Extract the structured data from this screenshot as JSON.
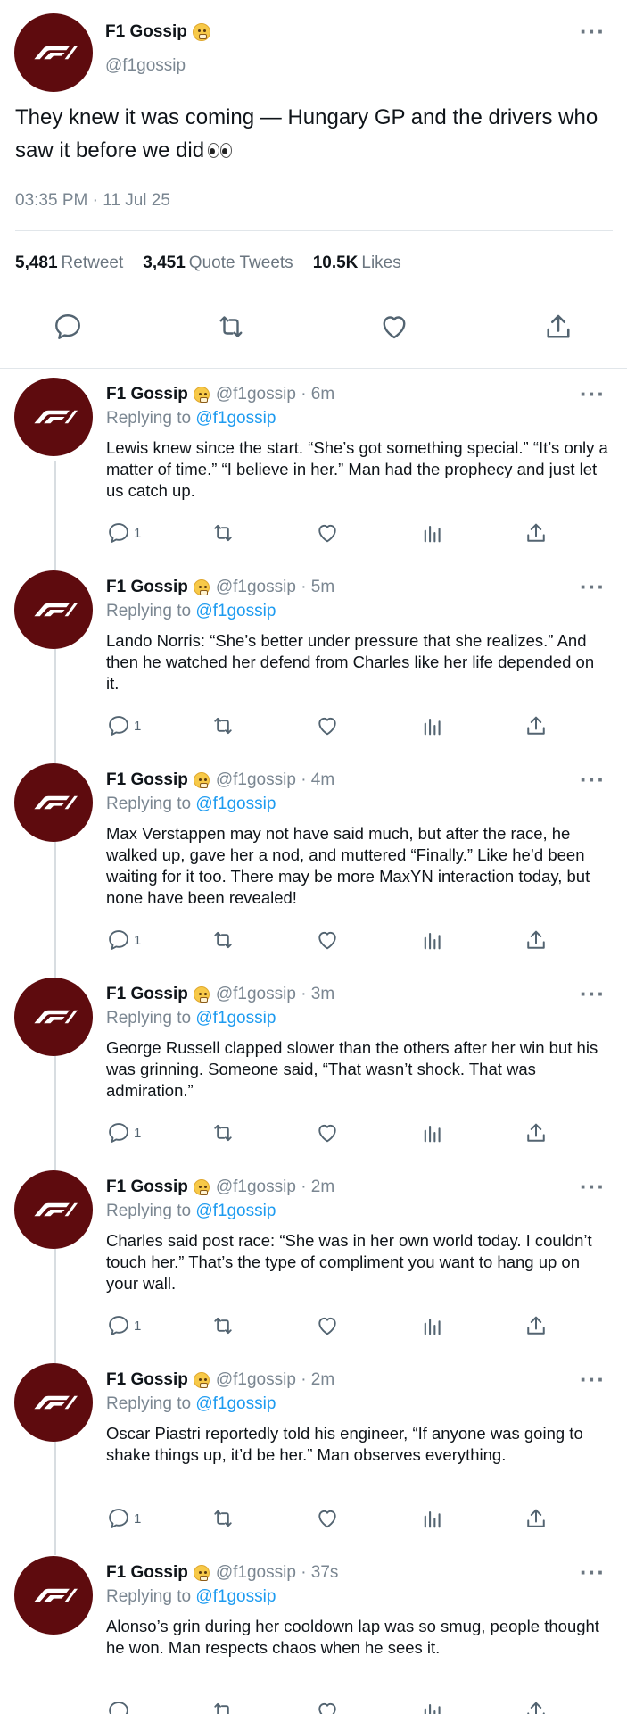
{
  "main_tweet": {
    "name": "F1 Gossip",
    "handle": "@f1gossip",
    "text": "They knew it was coming — Hungary GP and the drivers who saw it before we did",
    "timestamp": "03:35 PM · 11 Jul 25",
    "stats": {
      "retweets_count": "5,481",
      "retweets_label": "Retweet",
      "quotes_count": "3,451",
      "quotes_label": "Quote Tweets",
      "likes_count": "10.5K",
      "likes_label": "Likes"
    },
    "actions": [
      "reply-icon",
      "retweet-icon",
      "like-icon",
      "share-icon"
    ]
  },
  "replying_label": "Replying to",
  "replies": [
    {
      "name": "F1 Gossip",
      "handle_time": "@f1gossip · 6m",
      "replying_to": "@f1gossip",
      "text": "Lewis knew since the start. “She’s got something special.” “It’s only a matter of time.” “I believe in her.” Man had the prophecy and just let us catch up.",
      "reply_count": "1"
    },
    {
      "name": "F1 Gossip",
      "handle_time": "@f1gossip · 5m",
      "replying_to": "@f1gossip",
      "text": "Lando Norris: “She’s better under pressure that she realizes.” And then he watched her defend from Charles like her life depended on it.",
      "reply_count": "1"
    },
    {
      "name": "F1 Gossip",
      "handle_time": "@f1gossip · 4m",
      "replying_to": "@f1gossip",
      "text": "Max Verstappen may not have said much, but after the race, he walked up, gave her a nod, and muttered “Finally.” Like he’d been waiting for it too. There may be more MaxYN interaction today, but none have been revealed!",
      "reply_count": "1"
    },
    {
      "name": "F1 Gossip",
      "handle_time": "@f1gossip · 3m",
      "replying_to": "@f1gossip",
      "text": "George Russell clapped slower than the others after her win but his was grinning. Someone said, “That wasn’t shock. That was admiration.”",
      "reply_count": "1"
    },
    {
      "name": "F1 Gossip",
      "handle_time": "@f1gossip · 2m",
      "replying_to": "@f1gossip",
      "text": "Charles said post race: “She was in her own world today. I couldn’t touch her.” That’s the type of compliment you want to hang up on your wall.",
      "reply_count": "1"
    },
    {
      "name": "F1 Gossip",
      "handle_time": "@f1gossip · 2m",
      "replying_to": "@f1gossip",
      "text": "Oscar Piastri reportedly told his engineer, “If anyone was going to shake things up, it’d be her.” Man observes everything.",
      "reply_count": "1"
    },
    {
      "name": "F1 Gossip",
      "handle_time": "@f1gossip · 37s",
      "replying_to": "@f1gossip",
      "text": "Alonso’s grin during her cooldown lap was so smug, people thought he won. Man respects chaos when he sees it.",
      "reply_count": ""
    }
  ],
  "colors": {
    "avatar_bg": "#5e0b0e",
    "link": "#1d9bf0",
    "muted": "#7a8691"
  }
}
